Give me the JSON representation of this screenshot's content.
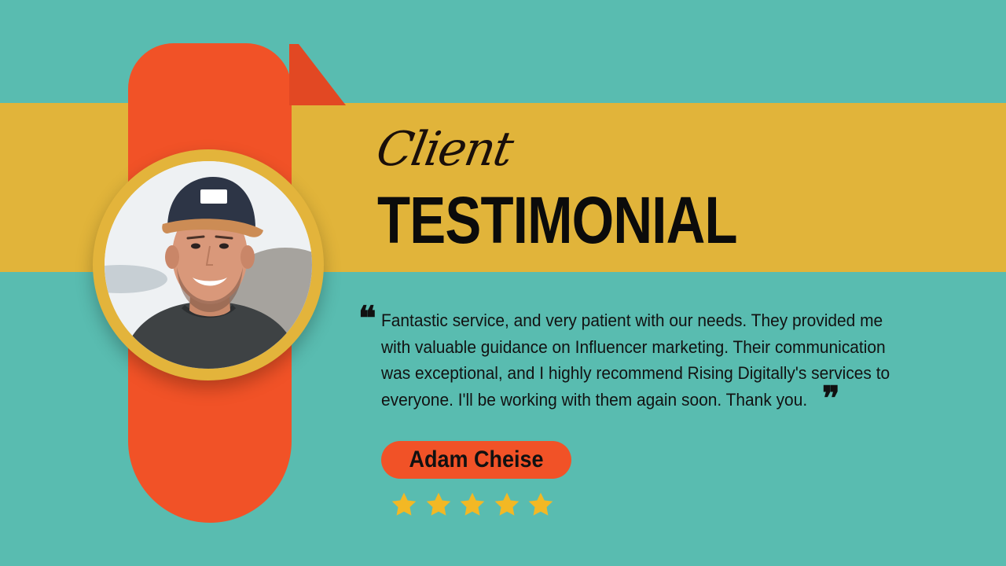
{
  "header": {
    "script_word": "Client",
    "title": "TESTIMONIAL"
  },
  "testimonial": {
    "open_quote": "❝",
    "text": "Fantastic service, and very patient with our needs. They provided me with valuable guidance on Influencer marketing. Their communication was exceptional, and I highly recommend Rising Digitally's services to everyone. I'll be working with them again soon. Thank you.",
    "close_quote": "❞"
  },
  "client": {
    "name": "Adam Cheise",
    "rating": 5,
    "rating_max": 5
  },
  "colors": {
    "background": "#59bcb0",
    "band": "#e1b43a",
    "accent": "#f15227",
    "star": "#f3b824"
  },
  "icons": [
    "quote-open-icon",
    "quote-close-icon",
    "star-icon"
  ]
}
